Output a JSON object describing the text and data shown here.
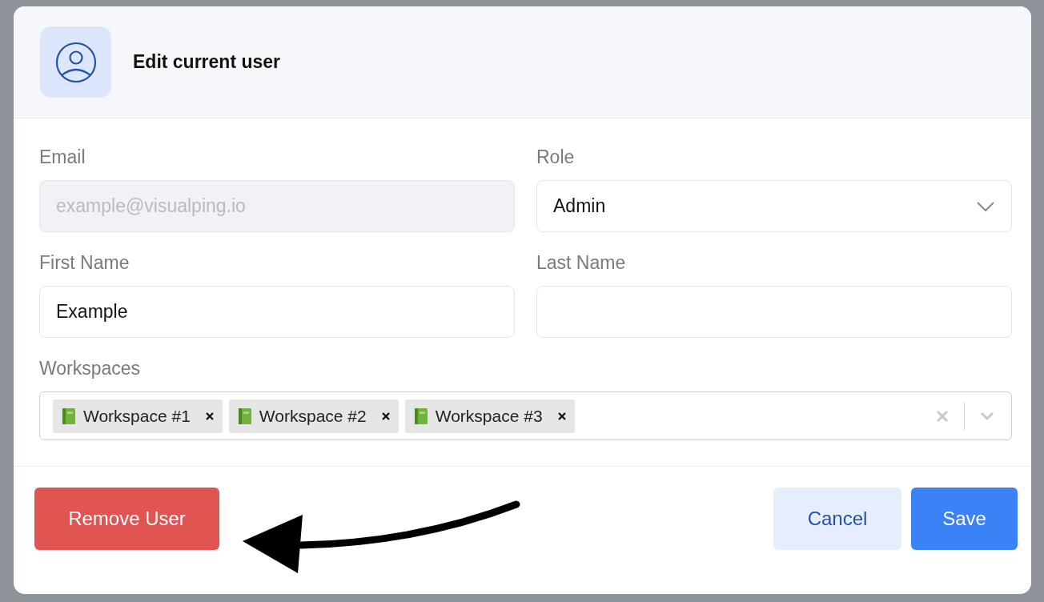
{
  "dialog": {
    "title": "Edit current user",
    "fields": [
      {
        "kind": "text",
        "label": "Email",
        "placeholder": "example@visualping.io",
        "disabled": true
      },
      {
        "kind": "select",
        "label": "Role",
        "value": "Admin"
      },
      {
        "kind": "text",
        "label": "First Name",
        "value": "Example",
        "disabled": false
      },
      {
        "kind": "text",
        "label": "Last Name",
        "disabled": false
      }
    ],
    "workspaces": {
      "label": "Workspaces",
      "tags": [
        {
          "label": "Workspace #1"
        },
        {
          "label": "Workspace #2"
        },
        {
          "label": "Workspace #3"
        }
      ]
    },
    "buttons": [
      {
        "label": "Remove User",
        "kind": "danger"
      },
      {
        "label": "Cancel",
        "kind": "secondary"
      },
      {
        "label": "Save",
        "kind": "primary"
      }
    ]
  }
}
